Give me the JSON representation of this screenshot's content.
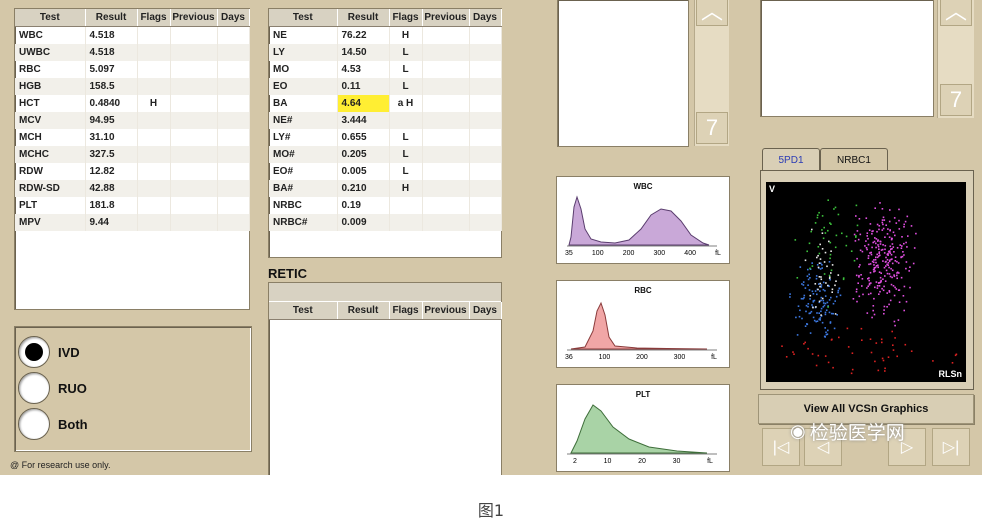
{
  "columns": [
    "Test",
    "Result",
    "Flags",
    "Previous",
    "Days"
  ],
  "left_table": [
    [
      "WBC",
      "4.518",
      ""
    ],
    [
      "UWBC",
      "4.518",
      ""
    ],
    [
      "RBC",
      "5.097",
      ""
    ],
    [
      "HGB",
      "158.5",
      ""
    ],
    [
      "HCT",
      "0.4840",
      "H"
    ],
    [
      "MCV",
      "94.95",
      ""
    ],
    [
      "MCH",
      "31.10",
      ""
    ],
    [
      "MCHC",
      "327.5",
      ""
    ],
    [
      "RDW",
      "12.82",
      ""
    ],
    [
      "RDW-SD",
      "42.88",
      ""
    ],
    [
      "PLT",
      "181.8",
      ""
    ],
    [
      "MPV",
      "9.44",
      ""
    ]
  ],
  "mid_table": [
    [
      "NE",
      "76.22",
      "H"
    ],
    [
      "LY",
      "14.50",
      "L"
    ],
    [
      "MO",
      "4.53",
      "L"
    ],
    [
      "EO",
      "0.11",
      "L"
    ],
    [
      "BA",
      "4.64",
      "a H"
    ],
    [
      "NE#",
      "3.444",
      ""
    ],
    [
      "LY#",
      "0.655",
      "L"
    ],
    [
      "MO#",
      "0.205",
      "L"
    ],
    [
      "EO#",
      "0.005",
      "L"
    ],
    [
      "BA#",
      "0.210",
      "H"
    ],
    [
      "NRBC",
      "0.19",
      ""
    ],
    [
      "NRBC#",
      "0.009",
      ""
    ]
  ],
  "retic_title": "RETIC",
  "modes": [
    "IVD",
    "RUO",
    "Both"
  ],
  "selected_mode": "IVD",
  "footer_note": "@ For research use only.",
  "histograms": {
    "wbc": {
      "title": "WBC",
      "ticks": [
        "35",
        "100",
        "200",
        "300",
        "400",
        "fL"
      ],
      "color": "#c9a8d8"
    },
    "rbc": {
      "title": "RBC",
      "ticks": [
        "36",
        "100",
        "200",
        "300",
        "fL"
      ],
      "color": "#f1a6a6"
    },
    "plt": {
      "title": "PLT",
      "ticks": [
        "2",
        "10",
        "20",
        "30",
        "fL"
      ],
      "color": "#a9d3a6"
    }
  },
  "tabs": [
    "5PD1",
    "NRBC1"
  ],
  "active_tab": "5PD1",
  "scatter": {
    "y_label": "V",
    "x_label": "RLSn"
  },
  "view_all_label": "View All VCSn Graphics",
  "nav_icons": [
    "first-icon",
    "prev-icon",
    "next-icon",
    "last-icon"
  ],
  "watermark_text": "检验医学网",
  "caption": "图1"
}
